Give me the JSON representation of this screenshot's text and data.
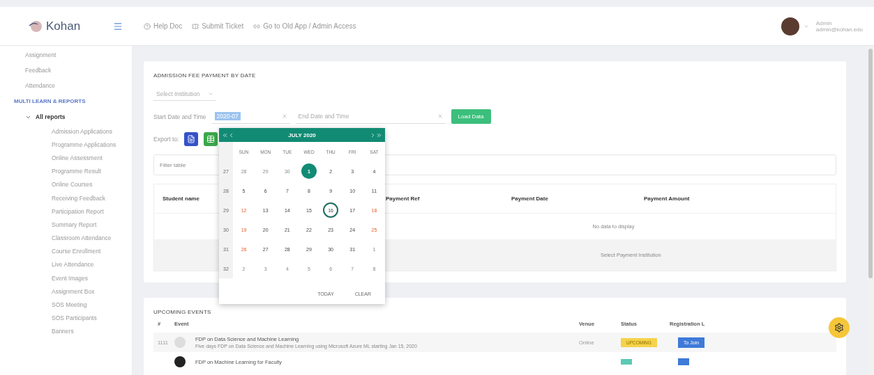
{
  "header": {
    "logo": "Kohan",
    "links": [
      {
        "label": "Help Doc"
      },
      {
        "label": "Submit Ticket"
      },
      {
        "label": "Go to Old App / Admin Access"
      }
    ],
    "user": {
      "name": "Admin",
      "email": "admin@kohan.edu"
    }
  },
  "sidebar": {
    "items": [
      {
        "label": "Assignment"
      },
      {
        "label": "Feedback"
      },
      {
        "label": "Attendance"
      }
    ],
    "section": "MULTI LEARN & REPORTS",
    "group": {
      "label": "All reports",
      "expanded": true,
      "children": [
        {
          "label": "Admission Applications"
        },
        {
          "label": "Programme Applications"
        },
        {
          "label": "Online Assessment"
        },
        {
          "label": "Programme Result"
        },
        {
          "label": "Online Courses"
        },
        {
          "label": "Receiving Feedback"
        },
        {
          "label": "Participation Report"
        },
        {
          "label": "Summary Report"
        },
        {
          "label": "Classroom Attendance"
        },
        {
          "label": "Course Enrollment"
        },
        {
          "label": "Live Attendance"
        },
        {
          "label": "Event Images"
        },
        {
          "label": "Assignment Box"
        },
        {
          "label": "SOS Meeting"
        },
        {
          "label": "SOS Participants"
        },
        {
          "label": "Banners"
        }
      ]
    }
  },
  "report": {
    "title": "ADMISSION FEE PAYMENT BY DATE",
    "institution_select": {
      "placeholder": "Select Institution"
    },
    "start_label": "Start Date and Time",
    "start_value": "2020-07",
    "end_label": "End Date and Time",
    "load_button": "Load Data",
    "export_label": "Export to:",
    "search": {
      "placeholder": "Filter table"
    },
    "table": {
      "columns": [
        "Student name",
        "Payment Ref",
        "Payment Date",
        "Payment Amount"
      ],
      "empty": "No data to display",
      "footer": "Select Payment Institution"
    }
  },
  "calendar": {
    "title": "JULY 2020",
    "weekdays": [
      "SUN",
      "MON",
      "TUE",
      "WED",
      "THU",
      "FRI",
      "SAT"
    ],
    "weeks": [
      {
        "number": "27",
        "days": [
          {
            "label": "28",
            "kind": "other",
            "selected": false,
            "today": false
          },
          {
            "label": "29",
            "kind": "other",
            "selected": false,
            "today": false
          },
          {
            "label": "30",
            "kind": "other",
            "selected": false,
            "today": false
          },
          {
            "label": "1",
            "kind": "day",
            "selected": true,
            "today": false
          },
          {
            "label": "2",
            "kind": "day",
            "selected": false,
            "today": false
          },
          {
            "label": "3",
            "kind": "day",
            "selected": false,
            "today": false
          },
          {
            "label": "4",
            "kind": "day",
            "selected": false,
            "today": false
          }
        ]
      },
      {
        "number": "28",
        "days": [
          {
            "label": "5",
            "kind": "day",
            "selected": false,
            "today": false
          },
          {
            "label": "6",
            "kind": "day",
            "selected": false,
            "today": false
          },
          {
            "label": "7",
            "kind": "day",
            "selected": false,
            "today": false
          },
          {
            "label": "8",
            "kind": "day",
            "selected": false,
            "today": false
          },
          {
            "label": "9",
            "kind": "day",
            "selected": false,
            "today": false
          },
          {
            "label": "10",
            "kind": "day",
            "selected": false,
            "today": false
          },
          {
            "label": "11",
            "kind": "day",
            "selected": false,
            "today": false
          }
        ]
      },
      {
        "number": "29",
        "days": [
          {
            "label": "12",
            "kind": "weekend",
            "selected": false,
            "today": false
          },
          {
            "label": "13",
            "kind": "day",
            "selected": false,
            "today": false
          },
          {
            "label": "14",
            "kind": "day",
            "selected": false,
            "today": false
          },
          {
            "label": "15",
            "kind": "day",
            "selected": false,
            "today": false
          },
          {
            "label": "16",
            "kind": "day",
            "selected": false,
            "today": true
          },
          {
            "label": "17",
            "kind": "day",
            "selected": false,
            "today": false
          },
          {
            "label": "18",
            "kind": "weekend",
            "selected": false,
            "today": false
          }
        ]
      },
      {
        "number": "30",
        "days": [
          {
            "label": "19",
            "kind": "weekend",
            "selected": false,
            "today": false
          },
          {
            "label": "20",
            "kind": "day",
            "selected": false,
            "today": false
          },
          {
            "label": "21",
            "kind": "day",
            "selected": false,
            "today": false
          },
          {
            "label": "22",
            "kind": "day",
            "selected": false,
            "today": false
          },
          {
            "label": "23",
            "kind": "day",
            "selected": false,
            "today": false
          },
          {
            "label": "24",
            "kind": "day",
            "selected": false,
            "today": false
          },
          {
            "label": "25",
            "kind": "weekend",
            "selected": false,
            "today": false
          }
        ]
      },
      {
        "number": "31",
        "days": [
          {
            "label": "26",
            "kind": "weekend",
            "selected": false,
            "today": false
          },
          {
            "label": "27",
            "kind": "day",
            "selected": false,
            "today": false
          },
          {
            "label": "28",
            "kind": "day",
            "selected": false,
            "today": false
          },
          {
            "label": "29",
            "kind": "day",
            "selected": false,
            "today": false
          },
          {
            "label": "30",
            "kind": "day",
            "selected": false,
            "today": false
          },
          {
            "label": "31",
            "kind": "day",
            "selected": false,
            "today": false
          },
          {
            "label": "1",
            "kind": "other",
            "selected": false,
            "today": false
          }
        ]
      },
      {
        "number": "32",
        "days": [
          {
            "label": "2",
            "kind": "other",
            "selected": false,
            "today": false
          },
          {
            "label": "3",
            "kind": "other",
            "selected": false,
            "today": false
          },
          {
            "label": "4",
            "kind": "other",
            "selected": false,
            "today": false
          },
          {
            "label": "5",
            "kind": "other",
            "selected": false,
            "today": false
          },
          {
            "label": "6",
            "kind": "other",
            "selected": false,
            "today": false
          },
          {
            "label": "7",
            "kind": "other",
            "selected": false,
            "today": false
          },
          {
            "label": "8",
            "kind": "other",
            "selected": false,
            "today": false
          }
        ]
      }
    ],
    "buttons": [
      "TODAY",
      "CLEAR"
    ]
  },
  "events": {
    "title": "UPCOMING EVENTS",
    "columns": [
      "#",
      "Event",
      "Venue",
      "Status",
      "Registration L"
    ],
    "rows": [
      {
        "id": "1111",
        "title": "FDP on Data Science and Machine Learning",
        "description": "Five days FDP on Data Science and Machine Learning using Microsoft Azure ML starting Jan 15, 2020",
        "venue": "Online",
        "status": "UPCOMING",
        "color": "#f5d34a",
        "action": "To Join"
      },
      {
        "id": "",
        "title": "FDP on Machine Learning for Faculty",
        "description": "",
        "venue": "",
        "status": "",
        "color": "#5cc9b5",
        "action": ""
      }
    ]
  }
}
